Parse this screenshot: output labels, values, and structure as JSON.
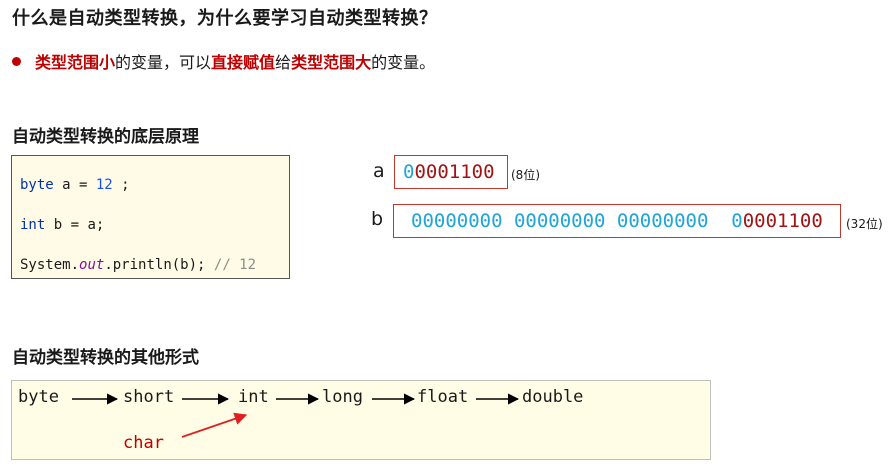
{
  "title": "什么是自动类型转换，为什么要学习自动类型转换？",
  "bullet": {
    "part1": "类型范围小",
    "part2": "的变量，可以",
    "part3": "直接赋值",
    "part4": "给",
    "part5": "类型范围大",
    "part6": "的变量。"
  },
  "section1": {
    "title": "自动类型转换的底层原理",
    "code": {
      "line1": {
        "keyword": "byte",
        "middle": " a = ",
        "number": "12",
        "tail": " ;"
      },
      "line2": {
        "keyword": "int",
        "tail": " b = a;"
      },
      "line3": {
        "prefix": "System.",
        "field": "out",
        "middle": ".println(b); ",
        "comment": "// 12"
      }
    },
    "var_a": {
      "label": "a",
      "bits_blue": "0",
      "bits_red": "0001100",
      "size_note": "(8位)"
    },
    "var_b": {
      "label": "b",
      "bits_blue": "00000000 00000000 00000000  0",
      "bits_red": "0001100",
      "size_note": "(32位)"
    }
  },
  "section2": {
    "title": "自动类型转换的其他形式",
    "types": [
      "byte",
      "short",
      "int",
      "long",
      "float",
      "double"
    ],
    "char_label": "char"
  },
  "colors": {
    "emphasis_red": "#c00000",
    "bit_blue": "#1fa5d8",
    "bit_red": "#a31515",
    "code_bg": "#fffbe6"
  }
}
